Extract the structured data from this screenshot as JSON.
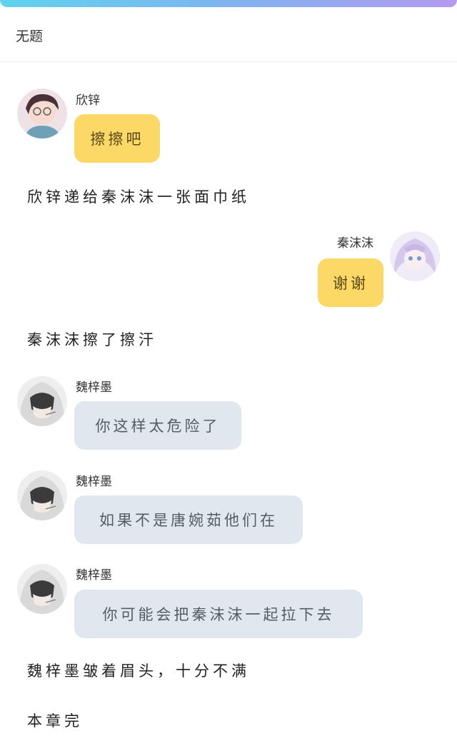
{
  "header": {
    "title": "无题"
  },
  "messages": [
    {
      "speaker": "欣锌",
      "text": "擦擦吧",
      "side": "left",
      "bubble_color": "#fcd866",
      "avatar_icon": "boy-glasses-avatar"
    },
    {
      "narration": "欣锌递给秦沫沫一张面巾纸"
    },
    {
      "speaker": "秦沫沫",
      "text": "谢谢",
      "side": "right",
      "bubble_color": "#fcd866",
      "avatar_icon": "girl-purple-hair-avatar"
    },
    {
      "narration": "秦沫沫擦了擦汗"
    },
    {
      "speaker": "魏梓墨",
      "text": "你这样太危险了",
      "side": "left",
      "bubble_color": "#e1e7ee",
      "avatar_icon": "boy-hood-avatar"
    },
    {
      "speaker": "魏梓墨",
      "text": "如果不是唐婉茹他们在",
      "side": "left",
      "bubble_color": "#e1e7ee",
      "avatar_icon": "boy-hood-avatar"
    },
    {
      "speaker": "魏梓墨",
      "text": "你可能会把秦沫沫一起拉下去",
      "side": "left",
      "bubble_color": "#e1e7ee",
      "avatar_icon": "boy-hood-avatar"
    },
    {
      "narration": "魏梓墨皱着眉头，十分不满"
    },
    {
      "narration": "本章完"
    }
  ],
  "colors": {
    "accent_start": "#5fd3ee",
    "accent_end": "#b49af0",
    "yellow_bubble": "#fcd866",
    "gray_bubble": "#e1e7ee"
  }
}
